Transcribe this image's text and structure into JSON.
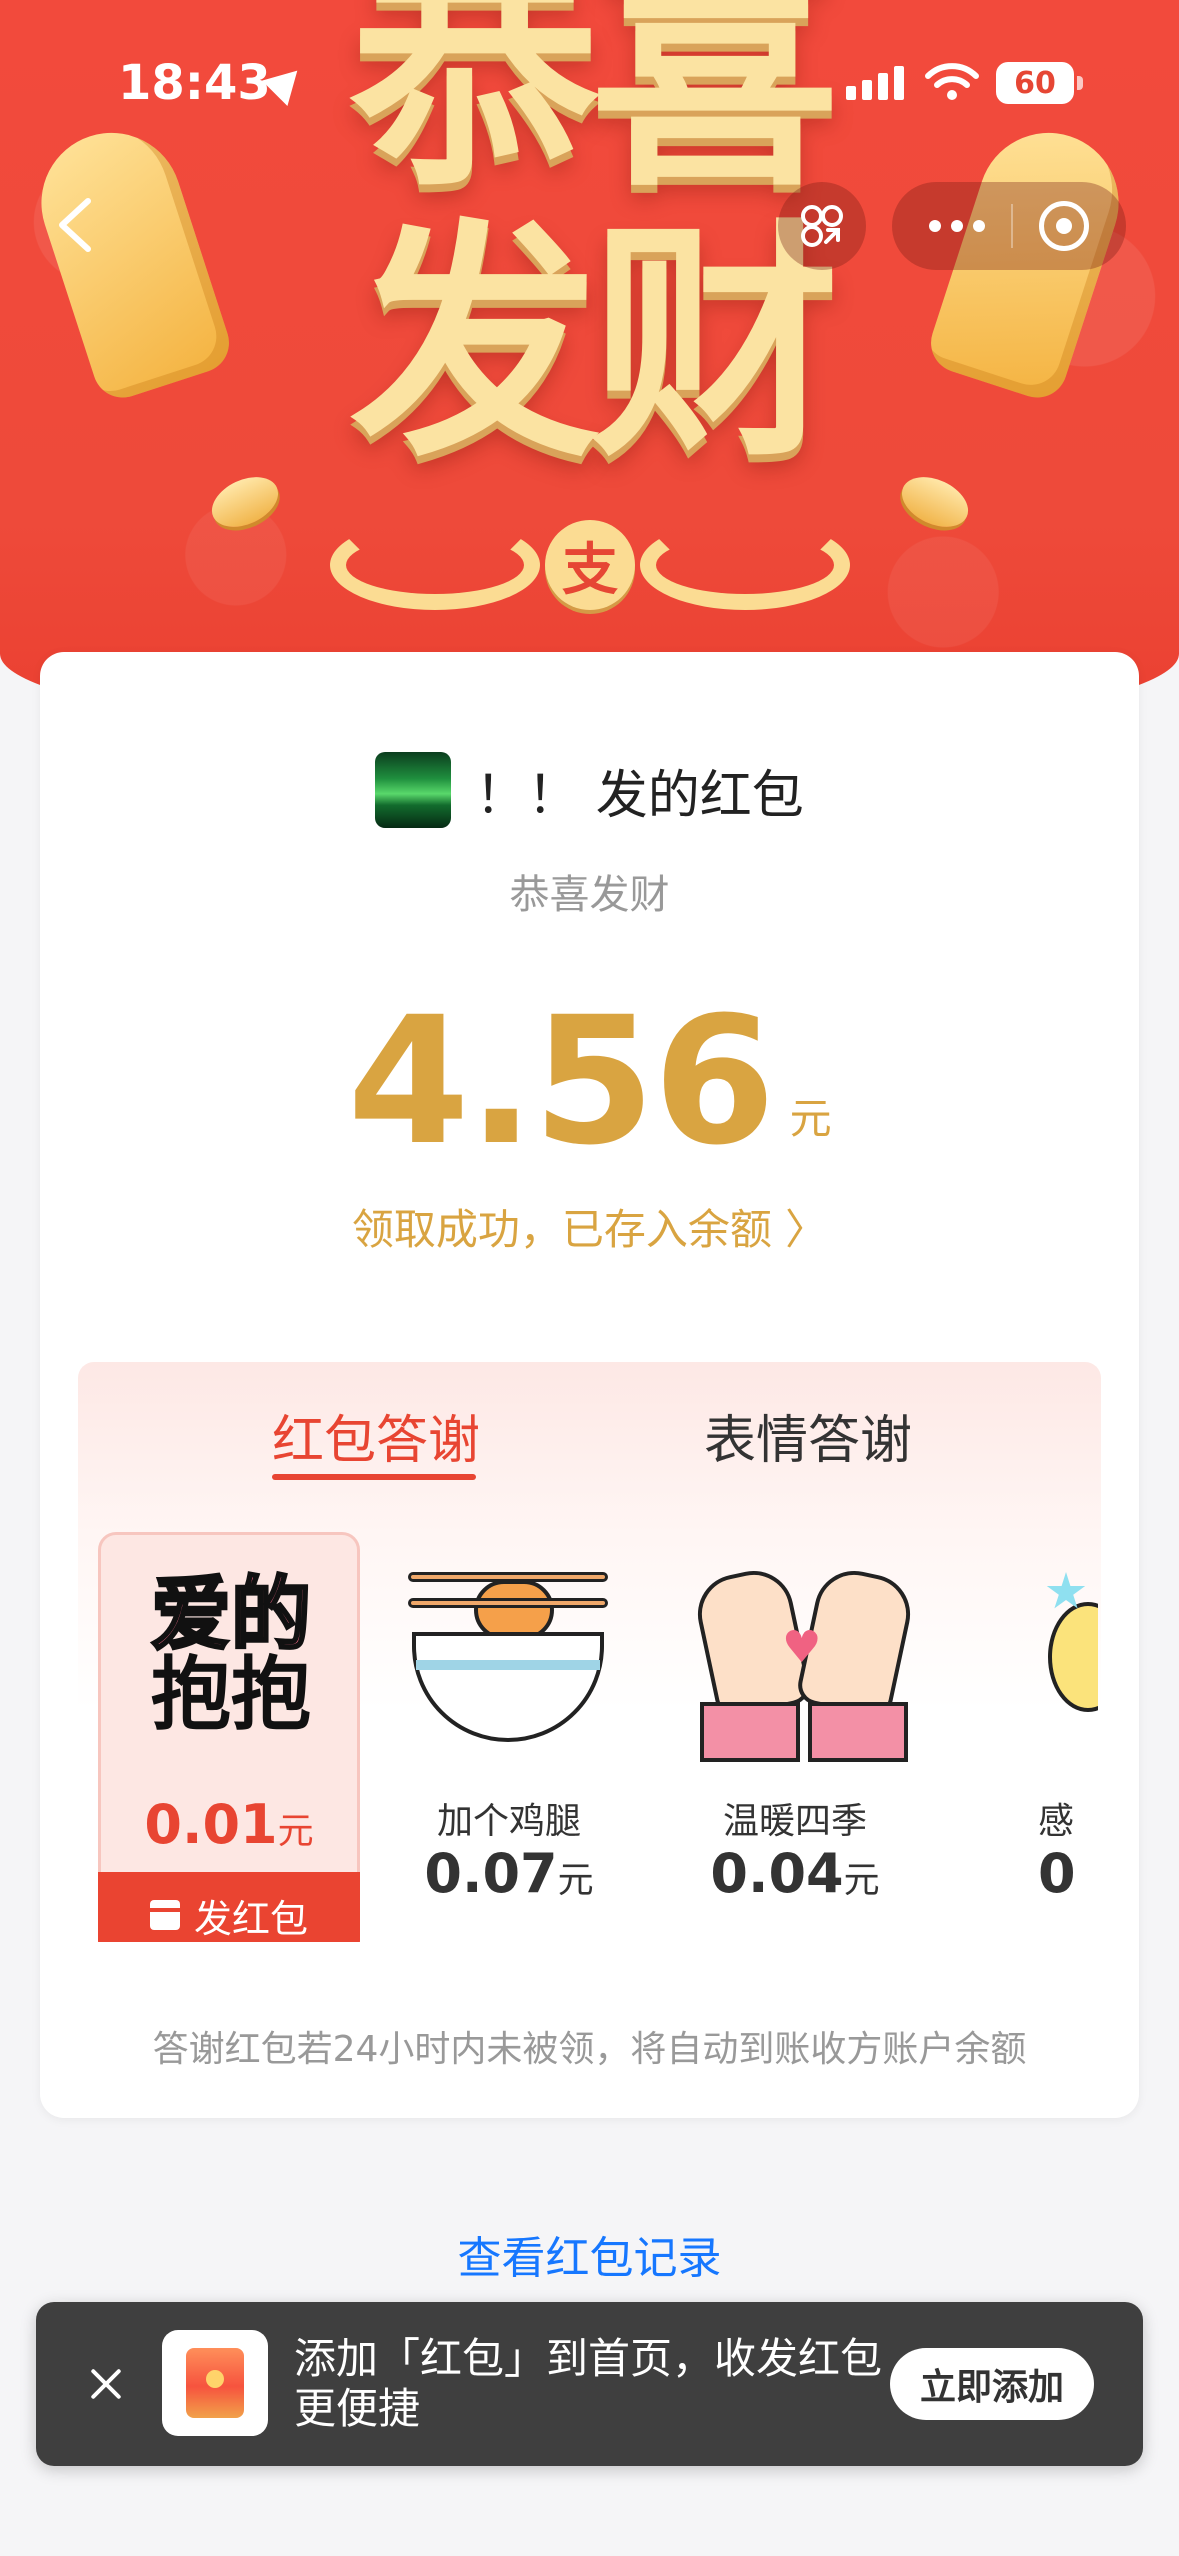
{
  "status_bar": {
    "time": "18:43",
    "battery": "60"
  },
  "banner": {
    "title_line1": "恭喜",
    "title_line2": "发财",
    "seal_char": "支"
  },
  "nav": {
    "back_icon": "chevron-left-icon",
    "scan_icon": "scan-icon",
    "more_icon": "more-dots-icon",
    "close_icon": "target-icon"
  },
  "card": {
    "sender_name": "！！ 发的红包",
    "blessing": "恭喜发财",
    "amount": "4.56",
    "amount_unit": "元",
    "deposit_text": "领取成功，已存入余额 〉"
  },
  "thanks": {
    "tabs": [
      {
        "label": "红包答谢",
        "active": true
      },
      {
        "label": "表情答谢",
        "active": false
      }
    ],
    "items": [
      {
        "sticker_text_line1": "爱的",
        "sticker_text_line2": "抱抱",
        "price": "0.01",
        "unit": "元",
        "action": "发红包"
      },
      {
        "name": "加个鸡腿",
        "price": "0.07",
        "unit": "元"
      },
      {
        "name": "温暖四季",
        "price": "0.04",
        "unit": "元"
      },
      {
        "name": "感",
        "price": "0"
      }
    ],
    "auto_note": "答谢红包若24小时内未被领，将自动到账收方账户余额"
  },
  "records_link": "查看红包记录",
  "toast": {
    "text": "添加「红包」到首页，收发红包更便捷",
    "button": "立即添加"
  },
  "colors": {
    "banner_red": "#ef4a3b",
    "gold": "#d9a441",
    "accent_red": "#e84532",
    "link_blue": "#1677ff"
  }
}
